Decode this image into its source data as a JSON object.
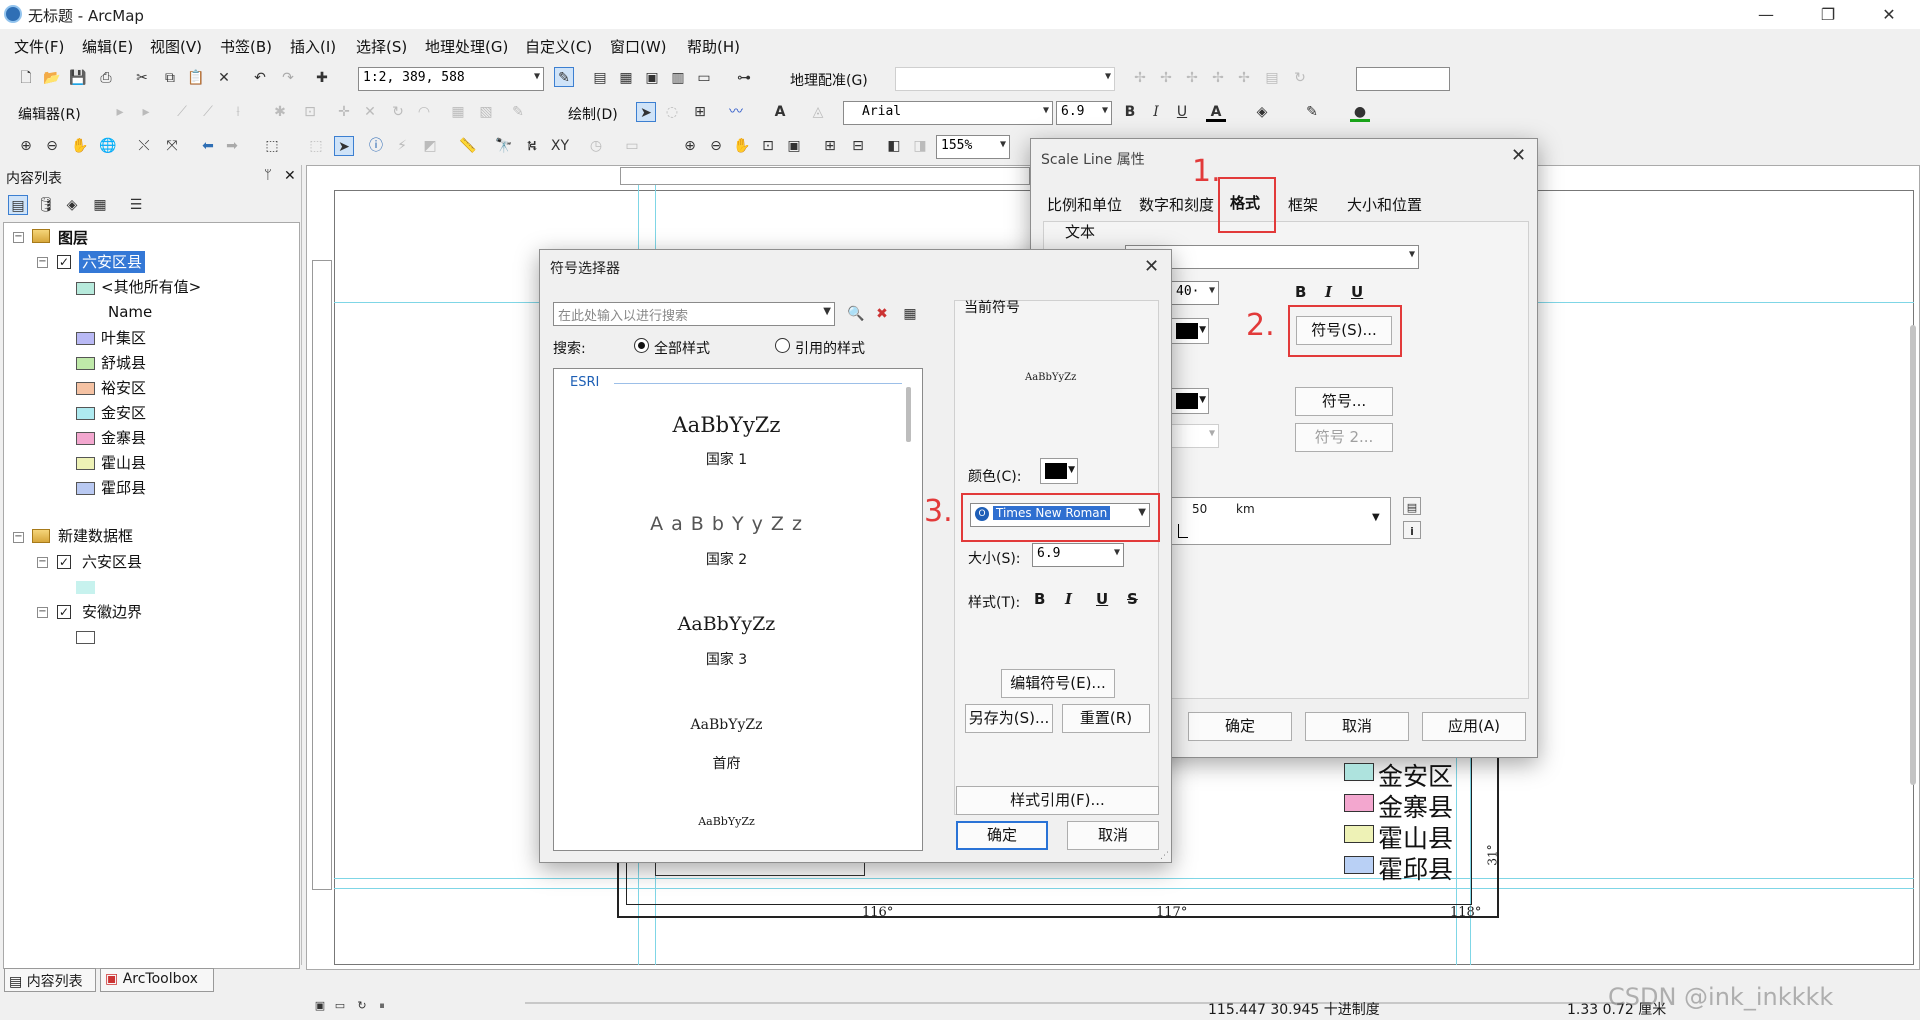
{
  "window": {
    "title": "无标题 - ArcMap",
    "minimize": "—",
    "maximize": "❐",
    "close": "✕"
  },
  "menu": [
    "文件(F)",
    "编辑(E)",
    "视图(V)",
    "书签(B)",
    "插入(I)",
    "选择(S)",
    "地理处理(G)",
    "自定义(C)",
    "窗口(W)",
    "帮助(H)"
  ],
  "toolbar": {
    "scale_value": "1:2, 389, 588",
    "georef_label": "地理配准(G)",
    "editor_label": "编辑器(R)",
    "draw_label": "绘制(D)",
    "font_value": "Arial",
    "font_size": "6.9",
    "zoom_value": "155%"
  },
  "toc": {
    "title": "内容列表",
    "pin": "ᛘ",
    "close": "✕",
    "frame1": "图层",
    "layer1": "六安区县",
    "other_values": "<其他所有值>",
    "field_name": "Name",
    "classes": [
      {
        "label": "叶集区",
        "color": "#b9b9f5"
      },
      {
        "label": "舒城县",
        "color": "#bfe9a9"
      },
      {
        "label": "裕安区",
        "color": "#f5c2a3"
      },
      {
        "label": "金安区",
        "color": "#aeeaf0"
      },
      {
        "label": "金寨县",
        "color": "#f3a7cf"
      },
      {
        "label": "霍山县",
        "color": "#eef2b6"
      },
      {
        "label": "霍邱县",
        "color": "#b9c9f2"
      }
    ],
    "other_color": "#b7eadc",
    "frame2": "新建数据框",
    "layer2": "六安区县",
    "layer2_color": "#c7f2ee",
    "layer3": "安徽边界"
  },
  "bottom_tabs": {
    "toc": "内容列表",
    "toolbox": "ArcToolbox"
  },
  "map": {
    "lon_labels": [
      "116°",
      "117°",
      "118°"
    ],
    "lat_label": "31°",
    "legend": [
      {
        "label": "金安区",
        "color": "#aee3de"
      },
      {
        "label": "金寨县",
        "color": "#f3a7cf"
      },
      {
        "label": "霍山县",
        "color": "#eef2b6"
      },
      {
        "label": "霍邱县",
        "color": "#b9d0f5"
      }
    ]
  },
  "status": {
    "coords": "115.447  30.945 十进制度",
    "page_coords": "1.33  0.72 厘米",
    "watermark": "CSDN @ink_inkkkk"
  },
  "scale_dialog": {
    "title": "Scale Line 属性",
    "close": "✕",
    "tabs": [
      "比例和单位",
      "数字和刻度",
      "格式",
      "框架",
      "大小和位置"
    ],
    "group_text": "文本",
    "size_fragment": "40·",
    "symbol_btn": "符号(S)...",
    "symbol_btn2": "符号...",
    "symbol2_btn": "符号 2...",
    "preview_num": "50",
    "preview_unit": "km",
    "ok": "确定",
    "cancel": "取消",
    "apply": "应用(A)",
    "bold": "B",
    "italic": "I",
    "underline": "U"
  },
  "annotations": {
    "step1": "1.",
    "step2": "2.",
    "step3": "3."
  },
  "symbol_selector": {
    "title": "符号选择器",
    "close": "✕",
    "search_placeholder": "在此处输入以进行搜索",
    "search_label": "搜索:",
    "radio_all": "全部样式",
    "radio_ref": "引用的样式",
    "group": "ESRI",
    "items": [
      {
        "sample": "AaBbYyZz",
        "name": "国家 1"
      },
      {
        "sample": "A a B b Y y Z z",
        "name": "国家 2"
      },
      {
        "sample": "AaBbYyZz",
        "name": "国家 3"
      },
      {
        "sample": "AaBbYyZz",
        "name": "首府"
      },
      {
        "sample": "AaBbYyZz",
        "name": ""
      }
    ],
    "current_symbol_label": "当前符号",
    "preview_text": "AaBbYyZz",
    "color_label": "颜色(C):",
    "font_value": "Times New Roman",
    "size_label": "大小(S):",
    "size_value": "6.9",
    "style_label": "样式(T):",
    "style_b": "B",
    "style_i": "I",
    "style_u": "U",
    "style_s": "S",
    "edit_symbol": "编辑符号(E)...",
    "save_as": "另存为(S)...",
    "reset": "重置(R)",
    "style_refs": "样式引用(F)...",
    "ok": "确定",
    "cancel": "取消"
  }
}
